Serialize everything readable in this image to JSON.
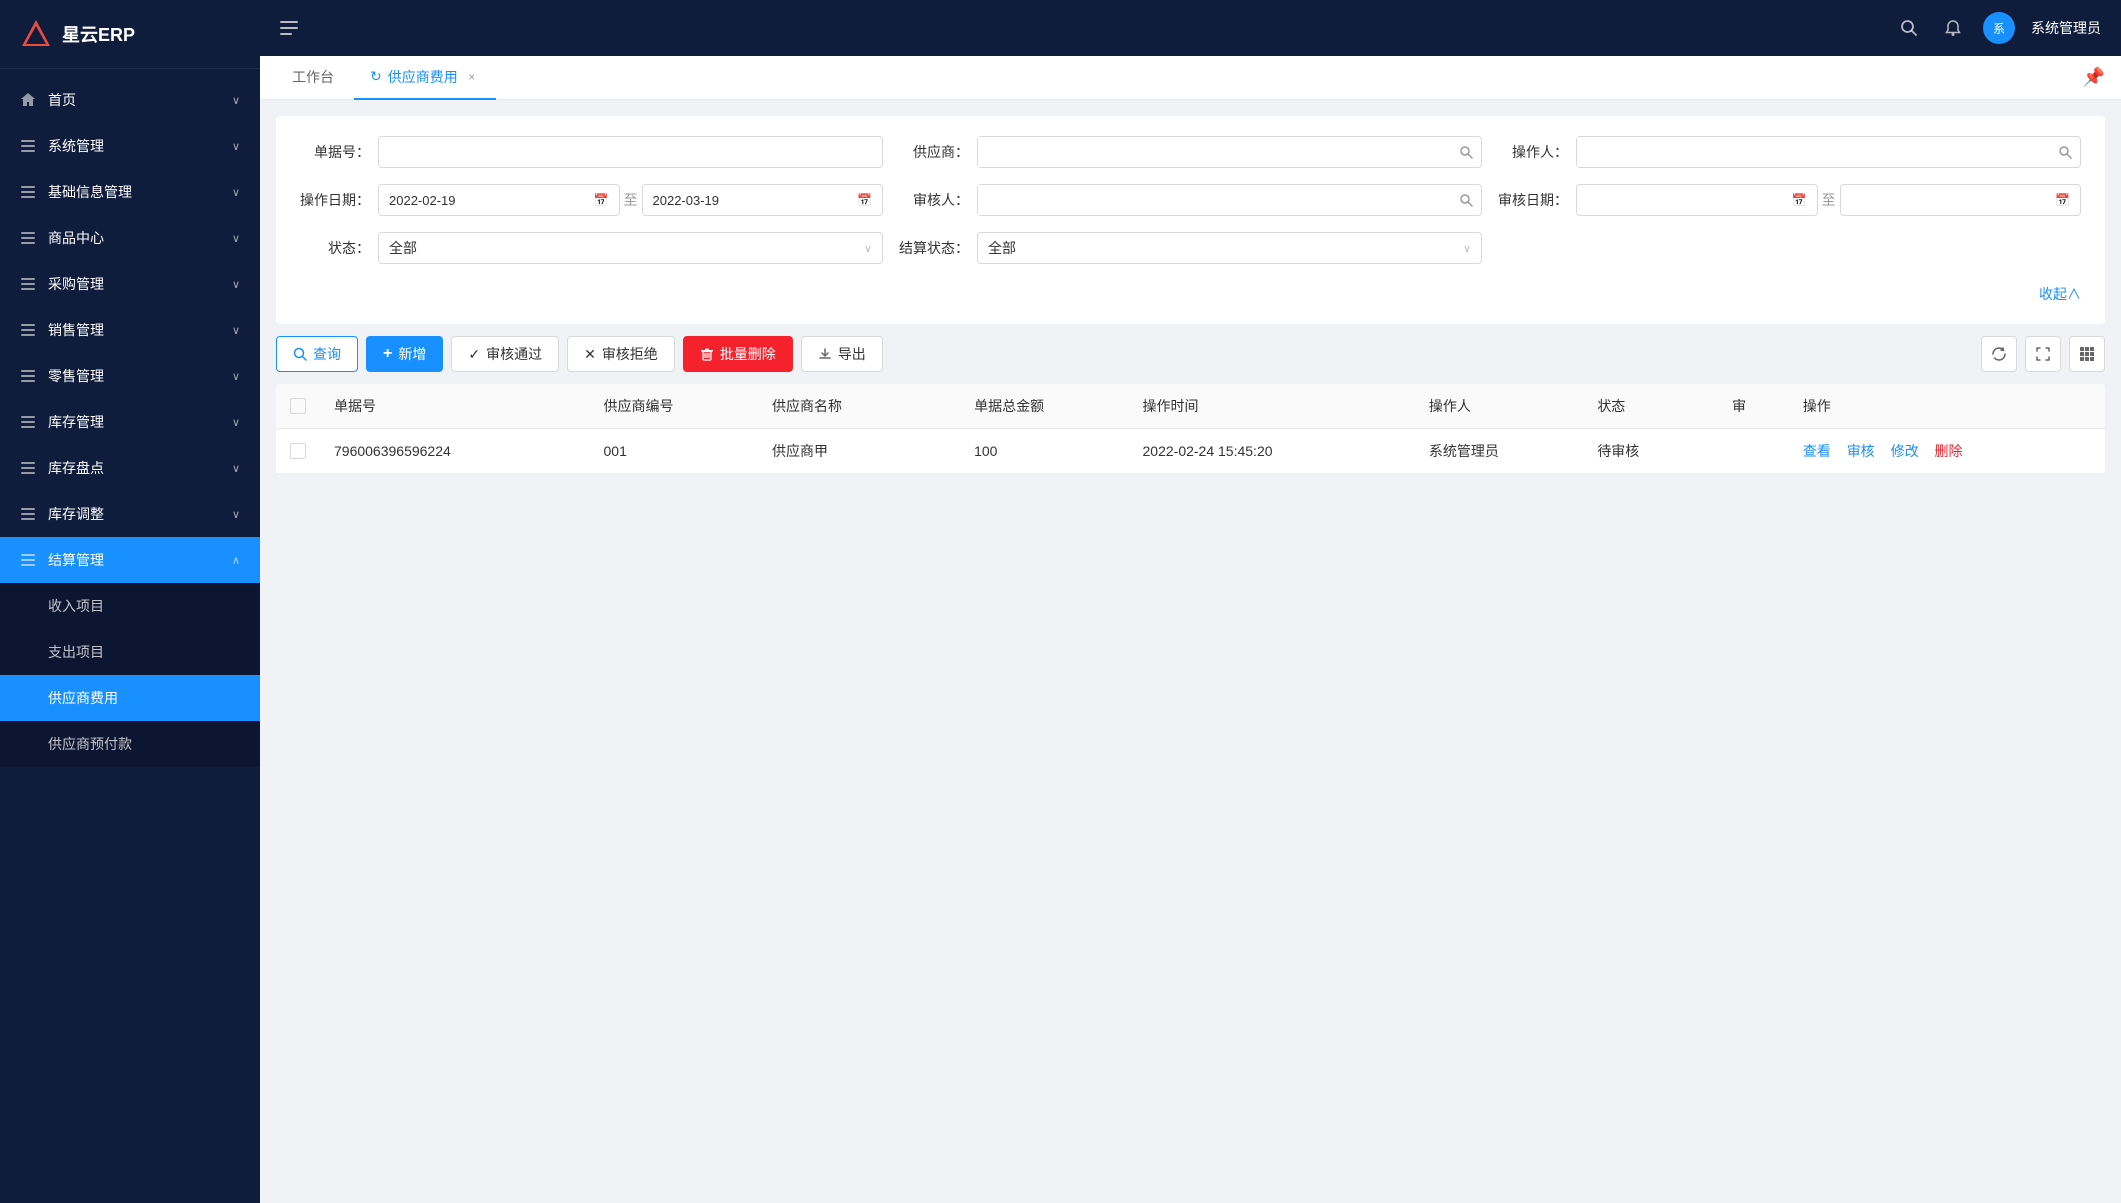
{
  "app": {
    "name": "星云ERP"
  },
  "header": {
    "user_name": "系统管理员",
    "avatar_text": "系"
  },
  "sidebar": {
    "menu_items": [
      {
        "id": "home",
        "label": "首页",
        "has_arrow": true,
        "active": false
      },
      {
        "id": "system",
        "label": "系统管理",
        "has_arrow": true,
        "active": false
      },
      {
        "id": "base-info",
        "label": "基础信息管理",
        "has_arrow": true,
        "active": false
      },
      {
        "id": "product",
        "label": "商品中心",
        "has_arrow": true,
        "active": false
      },
      {
        "id": "purchase",
        "label": "采购管理",
        "has_arrow": true,
        "active": false
      },
      {
        "id": "sales",
        "label": "销售管理",
        "has_arrow": true,
        "active": false
      },
      {
        "id": "retail",
        "label": "零售管理",
        "has_arrow": true,
        "active": false
      },
      {
        "id": "inventory",
        "label": "库存管理",
        "has_arrow": true,
        "active": false
      },
      {
        "id": "inventory-count",
        "label": "库存盘点",
        "has_arrow": true,
        "active": false
      },
      {
        "id": "inventory-adjust",
        "label": "库存调整",
        "has_arrow": true,
        "active": false
      },
      {
        "id": "settlement",
        "label": "结算管理",
        "has_arrow": true,
        "active": true,
        "expanded": true
      }
    ],
    "submenu_items": [
      {
        "id": "income",
        "label": "收入项目",
        "active": false
      },
      {
        "id": "expense",
        "label": "支出项目",
        "active": false
      },
      {
        "id": "supplier-cost",
        "label": "供应商费用",
        "active": true
      },
      {
        "id": "supplier-prepay",
        "label": "供应商预付款",
        "active": false
      }
    ]
  },
  "tabs": [
    {
      "id": "workbench",
      "label": "工作台",
      "closeable": false,
      "active": false
    },
    {
      "id": "supplier-cost",
      "label": "供应商费用",
      "closeable": true,
      "active": true,
      "refreshing": true
    }
  ],
  "filters": {
    "doc_no_label": "单据号：",
    "doc_no_placeholder": "",
    "supplier_label": "供应商：",
    "supplier_placeholder": "",
    "operator_label": "操作人：",
    "operator_placeholder": "",
    "op_date_label": "操作日期：",
    "op_date_from": "2022-02-19",
    "op_date_to": "2022-03-19",
    "auditor_label": "审核人：",
    "auditor_placeholder": "",
    "audit_date_label": "审核日期：",
    "audit_date_from": "",
    "audit_date_to": "",
    "status_label": "状态：",
    "status_value": "全部",
    "settle_status_label": "结算状态：",
    "settle_status_value": "全部",
    "collapse_label": "收起∧"
  },
  "toolbar": {
    "query_label": "查询",
    "add_label": "新增",
    "approve_label": "审核通过",
    "reject_label": "审核拒绝",
    "batch_delete_label": "批量删除",
    "export_label": "导出"
  },
  "table": {
    "columns": [
      {
        "id": "checkbox",
        "label": ""
      },
      {
        "id": "doc_no",
        "label": "单据号"
      },
      {
        "id": "supplier_code",
        "label": "供应商编号"
      },
      {
        "id": "supplier_name",
        "label": "供应商名称"
      },
      {
        "id": "total_amount",
        "label": "单据总金额"
      },
      {
        "id": "op_time",
        "label": "操作时间"
      },
      {
        "id": "operator",
        "label": "操作人"
      },
      {
        "id": "status",
        "label": "状态"
      },
      {
        "id": "audit",
        "label": "审"
      },
      {
        "id": "action",
        "label": "操作"
      }
    ],
    "rows": [
      {
        "doc_no": "796006396596224",
        "supplier_code": "001",
        "supplier_name": "供应商甲",
        "total_amount": "100",
        "op_time": "2022-02-24 15:45:20",
        "operator": "系统管理员",
        "status": "待审核",
        "audit": "",
        "actions": [
          "查看",
          "审核",
          "修改",
          "删除"
        ]
      }
    ]
  }
}
